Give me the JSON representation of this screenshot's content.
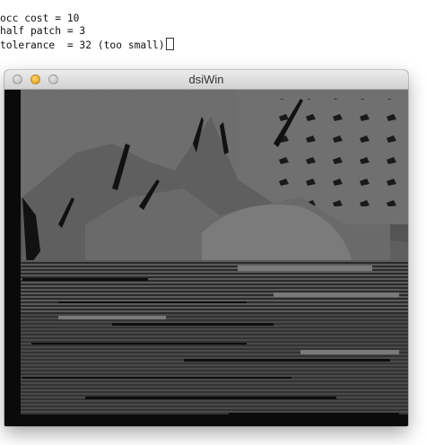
{
  "terminal": {
    "lines": [
      "occ cost = 10",
      "half patch = 3",
      "tolerance  = 32 (too small)"
    ]
  },
  "window": {
    "title": "dsiWin",
    "buttons": [
      "close-icon",
      "minimize-icon",
      "zoom-icon"
    ],
    "colors": {
      "close": "#c8c8c8",
      "minimize": "#f0ad2a",
      "zoom": "#c8c8c8"
    }
  }
}
